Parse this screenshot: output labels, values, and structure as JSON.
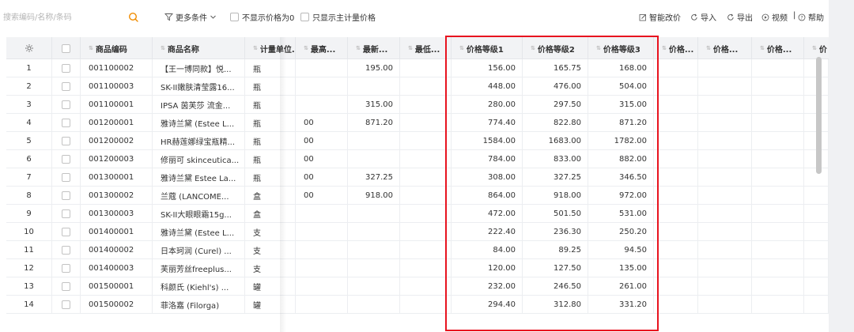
{
  "toolbar": {
    "search_placeholder": "搜索编码/名称/条码",
    "more_conditions": "更多条件",
    "hide_price0": "不显示价格为0",
    "main_unit_only": "只显示主计量价格",
    "smart_price": "智能改价",
    "import": "导入",
    "export": "导出",
    "video": "视频",
    "help": "帮助",
    "sep": "|"
  },
  "table": {
    "headers": {
      "code": "商品编码",
      "name": "商品名称",
      "unit": "计量单位...",
      "highest": "最高...",
      "latest": "最新...",
      "lowest": "最低...",
      "level1": "价格等级1",
      "level2": "价格等级2",
      "level3": "价格等级3",
      "p4": "价格...",
      "p5": "价格...",
      "p6": "价格...",
      "p7": "价 "
    },
    "rows": [
      {
        "no": "1",
        "code": "001100002",
        "name": "【王一博同款】悦...",
        "unit": "瓶",
        "hi": "",
        "latest": "195.00",
        "low": "",
        "l1": "156.00",
        "l2": "165.75",
        "l3": "168.00"
      },
      {
        "no": "2",
        "code": "001100003",
        "name": "SK-II嫩肤清莹露16...",
        "unit": "瓶",
        "hi": "",
        "latest": "",
        "low": "",
        "l1": "448.00",
        "l2": "476.00",
        "l3": "504.00"
      },
      {
        "no": "3",
        "code": "001100001",
        "name": "IPSA 茵芙莎 流金...",
        "unit": "瓶",
        "hi": "",
        "latest": "315.00",
        "low": "",
        "l1": "280.00",
        "l2": "297.50",
        "l3": "315.00"
      },
      {
        "no": "4",
        "code": "001200001",
        "name": "雅诗兰黛 (Estee L...",
        "unit": "瓶",
        "hi": "00",
        "latest": "871.20",
        "low": "",
        "l1": "774.40",
        "l2": "822.80",
        "l3": "871.20"
      },
      {
        "no": "5",
        "code": "001200002",
        "name": "HR赫莲娜绿宝瓶精...",
        "unit": "瓶",
        "hi": "00",
        "latest": "",
        "low": "",
        "l1": "1584.00",
        "l2": "1683.00",
        "l3": "1782.00"
      },
      {
        "no": "6",
        "code": "001200003",
        "name": "修丽可 skinceutica...",
        "unit": "瓶",
        "hi": "00",
        "latest": "",
        "low": "",
        "l1": "784.00",
        "l2": "833.00",
        "l3": "882.00"
      },
      {
        "no": "7",
        "code": "001300001",
        "name": "雅诗兰黛 Estee La...",
        "unit": "瓶",
        "hi": "00",
        "latest": "327.25",
        "low": "",
        "l1": "308.00",
        "l2": "327.25",
        "l3": "346.50"
      },
      {
        "no": "8",
        "code": "001300002",
        "name": "兰蔻 (LANCOME...",
        "unit": "盒",
        "hi": "00",
        "latest": "918.00",
        "low": "",
        "l1": "864.00",
        "l2": "918.00",
        "l3": "972.00"
      },
      {
        "no": "9",
        "code": "001300003",
        "name": "SK-II大眼眼霜15g...",
        "unit": "盒",
        "hi": "",
        "latest": "",
        "low": "",
        "l1": "472.00",
        "l2": "501.50",
        "l3": "531.00"
      },
      {
        "no": "10",
        "code": "001400001",
        "name": "雅诗兰黛 (Estee L...",
        "unit": "支",
        "hi": "",
        "latest": "",
        "low": "",
        "l1": "222.40",
        "l2": "236.30",
        "l3": "250.20"
      },
      {
        "no": "11",
        "code": "001400002",
        "name": "日本珂润 (Curel) ...",
        "unit": "支",
        "hi": "",
        "latest": "",
        "low": "",
        "l1": "84.00",
        "l2": "89.25",
        "l3": "94.50"
      },
      {
        "no": "12",
        "code": "001400003",
        "name": "芙丽芳丝freeplus...",
        "unit": "支",
        "hi": "",
        "latest": "",
        "low": "",
        "l1": "120.00",
        "l2": "127.50",
        "l3": "135.00"
      },
      {
        "no": "13",
        "code": "001500001",
        "name": "科颜氏 (Kiehl's) ...",
        "unit": "罐",
        "hi": "",
        "latest": "",
        "low": "",
        "l1": "232.00",
        "l2": "246.50",
        "l3": "261.00"
      },
      {
        "no": "14",
        "code": "001500002",
        "name": "菲洛嘉 (Filorga)",
        "unit": "罐",
        "hi": "",
        "latest": "",
        "low": "",
        "l1": "294.40",
        "l2": "312.80",
        "l3": "331.20"
      }
    ]
  },
  "colors": {
    "highlight": "#e8131f",
    "search_icon": "#f08c00",
    "header_bg": "#f2f3f5"
  }
}
